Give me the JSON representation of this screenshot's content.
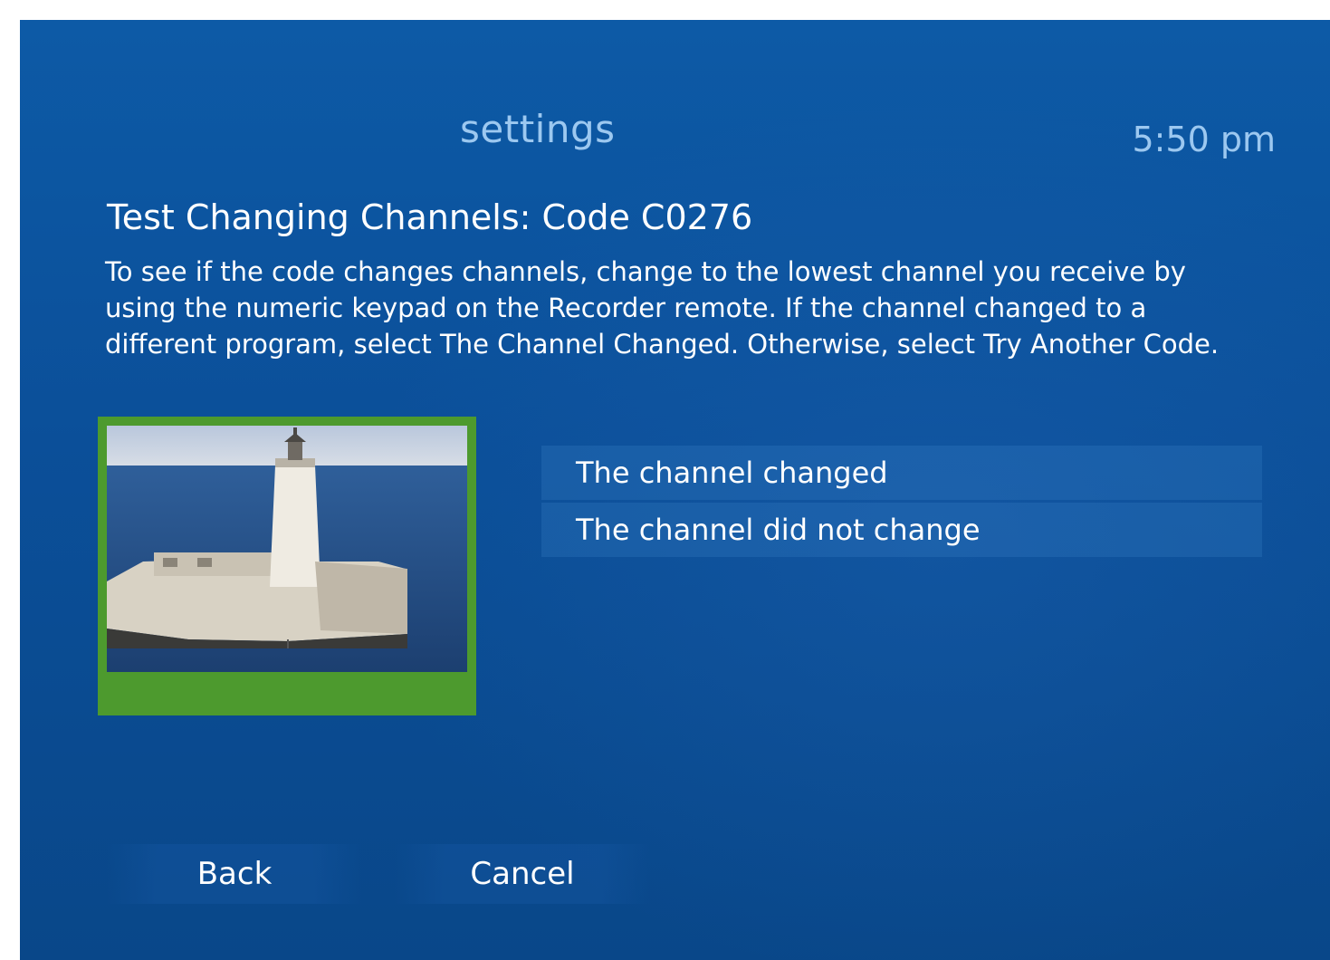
{
  "header": {
    "title": "settings",
    "time": "5:50 pm"
  },
  "main": {
    "heading": "Test Changing Channels: Code C0276",
    "description": "To see if the code changes channels, change to the lowest channel you receive by using the numeric keypad on the Recorder remote. If the channel changed to a different program, select The Channel Changed. Otherwise, select Try Another Code.",
    "options": [
      {
        "label": "The channel changed"
      },
      {
        "label": "The channel did not change"
      }
    ]
  },
  "footer": {
    "back_label": "Back",
    "cancel_label": "Cancel"
  },
  "colors": {
    "background": "#0b4f99",
    "preview_frame": "#4d9a2e",
    "title_text": "#9cc8f0"
  }
}
